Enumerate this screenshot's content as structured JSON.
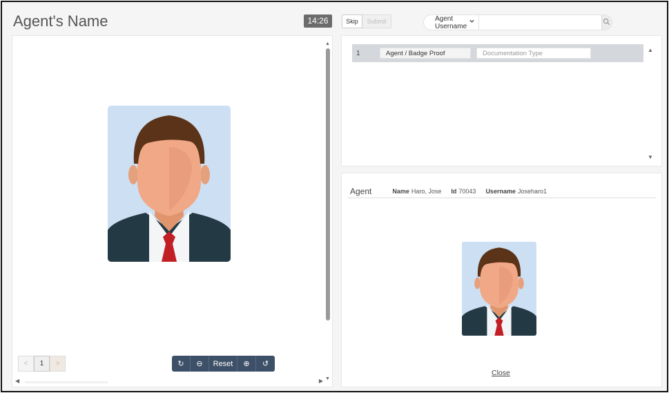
{
  "header": {
    "title": "Agent's Name",
    "timer": "14:26",
    "skip_label": "Skip",
    "submit_label": "Submit",
    "search": {
      "select_value": "Agent Username",
      "input_value": "",
      "placeholder": ""
    }
  },
  "viewer": {
    "pager": {
      "prev": "<",
      "current": "1",
      "next": ">"
    },
    "toolbar": {
      "rotate_cw": "↻",
      "zoom_out": "⊖",
      "reset": "Reset",
      "zoom_in": "⊕",
      "rotate_ccw": "↺"
    }
  },
  "documents": {
    "rows": [
      {
        "number": "1",
        "document": "Agent / Badge Proof",
        "type_placeholder": "Documentation Type"
      }
    ]
  },
  "agent": {
    "title": "Agent",
    "name_label": "Name",
    "name_value": "Haro, Jose",
    "id_label": "Id",
    "id_value": "70043",
    "username_label": "Username",
    "username_value": "Joseharo1",
    "close_label": "Close"
  },
  "icons": {
    "search": "search-icon",
    "dropdown": "chevron-down-icon",
    "rotate_cw": "rotate-cw-icon",
    "zoom_out": "zoom-out-icon",
    "zoom_in": "zoom-in-icon",
    "rotate_ccw": "rotate-ccw-icon"
  },
  "colors": {
    "toolbar": "#3d5067",
    "timer": "#6b6b6b",
    "row_highlight": "#d4d7db",
    "photo_bg": "#cddff3"
  }
}
